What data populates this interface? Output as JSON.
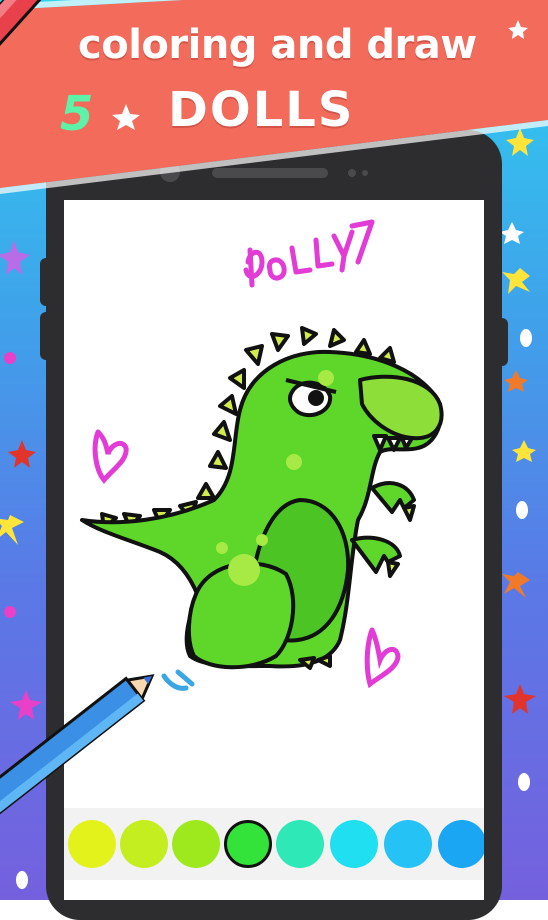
{
  "banner": {
    "line1": "coloring and draw",
    "line2": "DOLLS",
    "digit": "5",
    "background_color": "#f26b5b"
  },
  "canvas": {
    "scribble_text": "DOLLY7",
    "scribble_color": "#e23bd6",
    "subject_icon": "green-dinosaur-icon"
  },
  "palette": {
    "colors": [
      "#e3f21a",
      "#c4ee1f",
      "#9ee81e",
      "#33e33a",
      "#2ee8b8",
      "#1fdff0",
      "#25c2f5",
      "#1aa6f2"
    ],
    "selected_index": 3
  }
}
